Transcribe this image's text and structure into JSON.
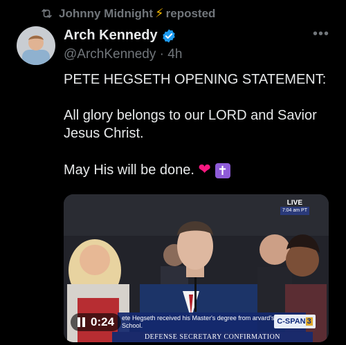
{
  "repost": {
    "name": "Johnny Midnight",
    "label": "reposted"
  },
  "author": {
    "name": "Arch Kennedy",
    "handle": "@ArchKennedy",
    "separator": "·",
    "time": "4h"
  },
  "tweet": {
    "line1": "PETE HEGSETH OPENING STATEMENT:",
    "line2": "All glory belongs to our LORD and Savior Jesus Christ.",
    "line3": "May His will be done."
  },
  "video": {
    "live_label": "LIVE",
    "live_time": "7:04 am PT",
    "caption": "ete Hegseth received his Master's degree from arvard's JFK School.",
    "banner": "DEFENSE SECRETARY CONFIRMATION",
    "network": "C-SPAN",
    "network_num": "3",
    "timestamp": "0:24"
  },
  "icons": {
    "repost": "repost-icon",
    "bolt": "lightning-bolt-icon",
    "verified": "verified-badge-icon",
    "more": "more-options-icon",
    "pause": "pause-icon"
  },
  "colors": {
    "background": "#000000",
    "text": "#e7e9ea",
    "muted": "#71767b",
    "verified": "#1d9bf0"
  }
}
